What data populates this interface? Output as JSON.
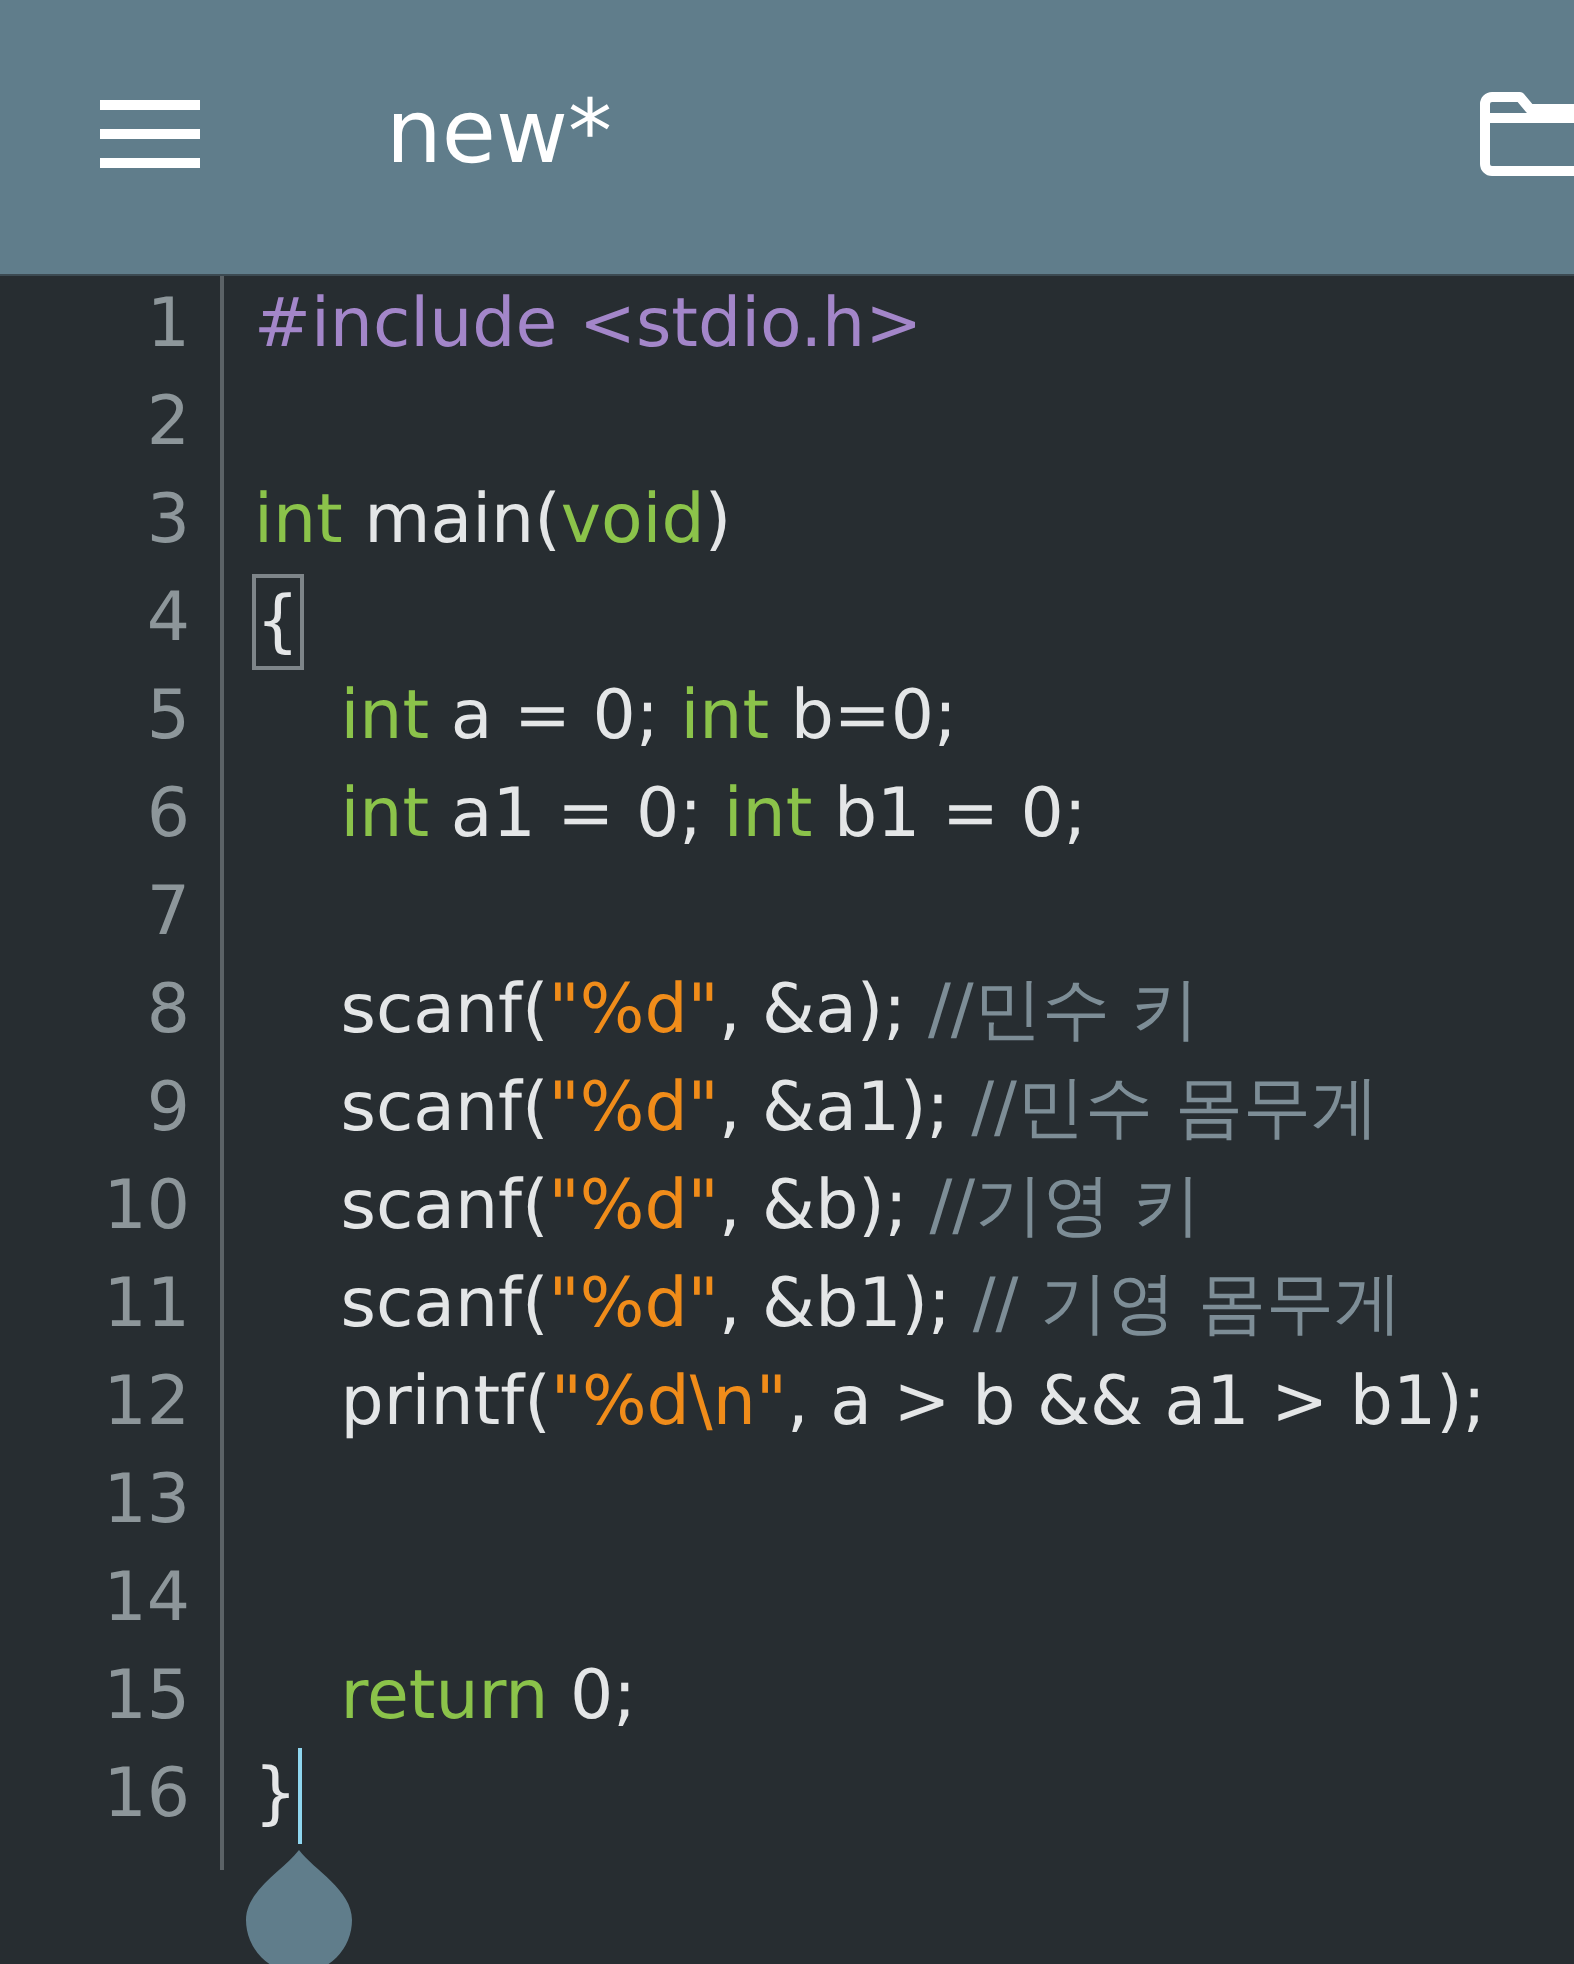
{
  "app_bar": {
    "title": "new*"
  },
  "editor": {
    "lines": [
      {
        "number": "1",
        "caret": false,
        "tokens": [
          {
            "text": "#include <stdio.h>",
            "kind": "preprocessor"
          }
        ]
      },
      {
        "number": "2",
        "caret": false
      },
      {
        "number": "3",
        "caret": false,
        "tokens": [
          {
            "text": "int",
            "kind": "keyword"
          },
          {
            "text": " main(",
            "kind": "plain"
          },
          {
            "text": "void",
            "kind": "keyword"
          },
          {
            "text": ")",
            "kind": "plain"
          }
        ]
      },
      {
        "number": "4",
        "caret": false,
        "tokens": [
          {
            "text": "{",
            "kind": "matched_bracket"
          }
        ]
      },
      {
        "number": "5",
        "caret": false,
        "tokens": [
          {
            "text": "    int",
            "kind": "keyword"
          },
          {
            "text": " a = 0; ",
            "kind": "plain"
          },
          {
            "text": "int",
            "kind": "keyword"
          },
          {
            "text": " b=0;",
            "kind": "plain"
          }
        ]
      },
      {
        "number": "6",
        "caret": false,
        "tokens": [
          {
            "text": "    int",
            "kind": "keyword"
          },
          {
            "text": " a1 = 0; ",
            "kind": "plain"
          },
          {
            "text": "int",
            "kind": "keyword"
          },
          {
            "text": " b1 = 0;",
            "kind": "plain"
          }
        ]
      },
      {
        "number": "7",
        "caret": false
      },
      {
        "number": "8",
        "caret": false,
        "tokens": [
          {
            "text": "    scanf(",
            "kind": "plain"
          },
          {
            "text": "\"%d\"",
            "kind": "string"
          },
          {
            "text": ", &a); ",
            "kind": "plain"
          },
          {
            "text": "//민수 키",
            "kind": "comment"
          }
        ]
      },
      {
        "number": "9",
        "caret": false,
        "tokens": [
          {
            "text": "    scanf(",
            "kind": "plain"
          },
          {
            "text": "\"%d\"",
            "kind": "string"
          },
          {
            "text": ", &a1); ",
            "kind": "plain"
          },
          {
            "text": "//민수 몸무게",
            "kind": "comment"
          }
        ]
      },
      {
        "number": "10",
        "caret": false,
        "tokens": [
          {
            "text": "    scanf(",
            "kind": "plain"
          },
          {
            "text": "\"%d\"",
            "kind": "string"
          },
          {
            "text": ", &b); ",
            "kind": "plain"
          },
          {
            "text": "//기영 키",
            "kind": "comment"
          }
        ]
      },
      {
        "number": "11",
        "caret": false,
        "tokens": [
          {
            "text": "    scanf(",
            "kind": "plain"
          },
          {
            "text": "\"%d\"",
            "kind": "string"
          },
          {
            "text": ", &b1); ",
            "kind": "plain"
          },
          {
            "text": "// 기영 몸무게",
            "kind": "comment"
          }
        ]
      },
      {
        "number": "12",
        "caret": false,
        "tokens": [
          {
            "text": "    printf(",
            "kind": "plain"
          },
          {
            "text": "\"%d\\n\"",
            "kind": "string"
          },
          {
            "text": ", a > b && a1 > b1);",
            "kind": "plain"
          }
        ]
      },
      {
        "number": "13",
        "caret": false
      },
      {
        "number": "14",
        "caret": false
      },
      {
        "number": "15",
        "caret": false,
        "tokens": [
          {
            "text": "    return",
            "kind": "keyword"
          },
          {
            "text": " 0;",
            "kind": "plain"
          }
        ]
      },
      {
        "number": "16",
        "caret": true,
        "tokens": [
          {
            "text": "}",
            "kind": "plain"
          }
        ]
      }
    ]
  }
}
